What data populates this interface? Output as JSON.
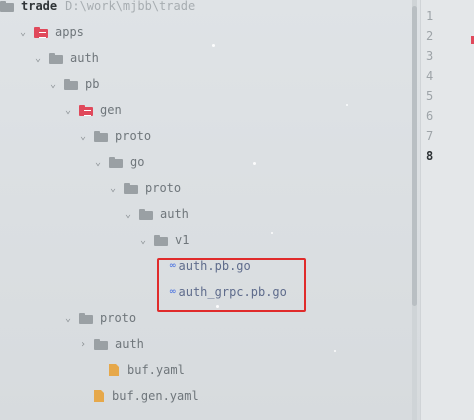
{
  "project": {
    "name": "trade",
    "path": "D:\\work\\mjbb\\trade"
  },
  "tree": [
    {
      "label": "apps",
      "kind": "folder-red",
      "depth": 1,
      "arrow": "down"
    },
    {
      "label": "auth",
      "kind": "folder",
      "depth": 2,
      "arrow": "down"
    },
    {
      "label": "pb",
      "kind": "folder",
      "depth": 3,
      "arrow": "down"
    },
    {
      "label": "gen",
      "kind": "folder-red",
      "depth": 4,
      "arrow": "down"
    },
    {
      "label": "proto",
      "kind": "folder",
      "depth": 5,
      "arrow": "down"
    },
    {
      "label": "go",
      "kind": "folder",
      "depth": 6,
      "arrow": "down"
    },
    {
      "label": "proto",
      "kind": "folder",
      "depth": 7,
      "arrow": "down"
    },
    {
      "label": "auth",
      "kind": "folder",
      "depth": 8,
      "arrow": "down"
    },
    {
      "label": "v1",
      "kind": "folder",
      "depth": 9,
      "arrow": "down"
    },
    {
      "label": "auth.pb.go",
      "kind": "go-file",
      "depth": 10,
      "arrow": "none"
    },
    {
      "label": "auth_grpc.pb.go",
      "kind": "go-file",
      "depth": 10,
      "arrow": "none"
    },
    {
      "label": "proto",
      "kind": "folder",
      "depth": 4,
      "arrow": "down"
    },
    {
      "label": "auth",
      "kind": "folder",
      "depth": 5,
      "arrow": "right"
    },
    {
      "label": "buf.yaml",
      "kind": "yaml-file",
      "depth": 6,
      "arrow": "none"
    },
    {
      "label": "buf.gen.yaml",
      "kind": "yaml-file",
      "depth": 5,
      "arrow": "none"
    }
  ],
  "go_icon_glyph": "∞",
  "gutter": {
    "lines": [
      "1",
      "2",
      "3",
      "4",
      "5",
      "6",
      "7",
      "8"
    ],
    "active_line": "8"
  },
  "colors": {
    "highlight": "#e02b2b",
    "module_folder": "#e0495b",
    "go_file": "#5b7fe0",
    "yaml_file": "#e6a84a"
  }
}
